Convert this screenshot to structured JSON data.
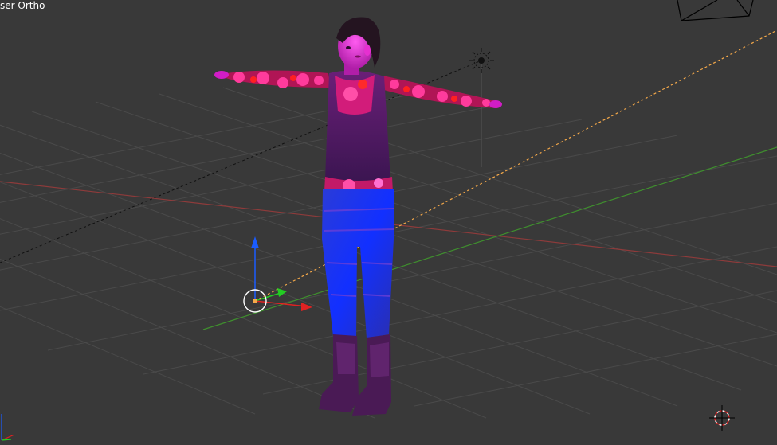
{
  "viewport": {
    "view_label": "ser Ortho",
    "background_color": "#393939",
    "grid_color": "#4a4a4a",
    "x_axis_color": "#8e3b3b",
    "y_axis_color": "#3f8f2e"
  },
  "scene": {
    "objects": [
      "character",
      "lamp",
      "camera",
      "3d-cursor",
      "object-origin"
    ],
    "selection_line_color": "#f5a94a",
    "relationship_line_color": "#111111"
  },
  "manipulator": {
    "z_color": "#1a5cff",
    "x_color": "#e02222",
    "y_color": "#22cc22"
  }
}
